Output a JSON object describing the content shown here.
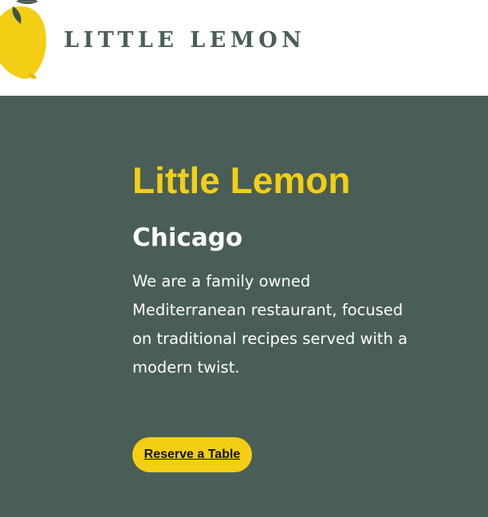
{
  "header": {
    "logo_text": "LITTLE LEMON",
    "logo_icon": "lemon-icon"
  },
  "hero": {
    "title": "Little Lemon",
    "subtitle": "Chicago",
    "description": "We are a family owned Mediterranean restaurant, focused on traditional recipes served with a modern twist.",
    "cta_label": "Reserve a Table"
  },
  "colors": {
    "primary_green": "#495e57",
    "primary_yellow": "#f4ce14",
    "white": "#ffffff"
  }
}
